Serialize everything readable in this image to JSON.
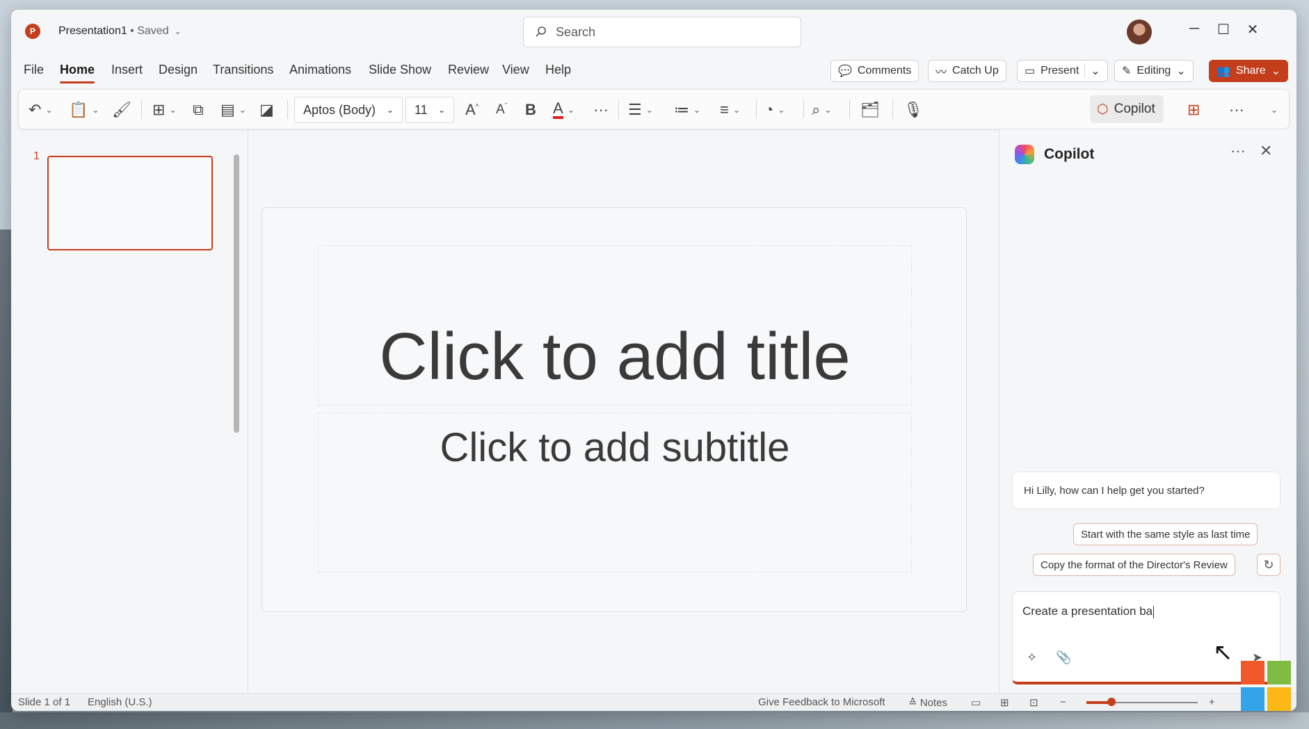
{
  "titlebar": {
    "app_icon_letter": "P",
    "doc_name": "Presentation1",
    "separator": " • ",
    "status": "Saved",
    "search_placeholder": "Search"
  },
  "menu": {
    "items": [
      "File",
      "Home",
      "Insert",
      "Design",
      "Transitions",
      "Animations",
      "Slide Show",
      "Review",
      "View",
      "Help"
    ],
    "active": "Home",
    "comments": "Comments",
    "catch_up": "Catch Up",
    "present": "Present",
    "editing": "Editing",
    "share": "Share"
  },
  "ribbon": {
    "font_name": "Aptos (Body)",
    "font_size": "11",
    "copilot": "Copilot",
    "font_color": "#e02020"
  },
  "thumbnails": {
    "slide_number": "1"
  },
  "slide": {
    "title_placeholder": "Click to add title",
    "subtitle_placeholder": "Click to add subtitle"
  },
  "copilot": {
    "title": "Copilot",
    "greeting": "Hi Lilly, how can I help get you started?",
    "suggestion_1": "Start with the same style as last time",
    "suggestion_2": "Copy the format of the Director's Review",
    "input_text": "Create a presentation ba"
  },
  "status": {
    "slide_info": "Slide 1 of 1",
    "language": "English (U.S.)",
    "feedback": "Give Feedback to Microsoft",
    "notes": "Notes"
  },
  "colors": {
    "accent": "#c43e1c"
  }
}
